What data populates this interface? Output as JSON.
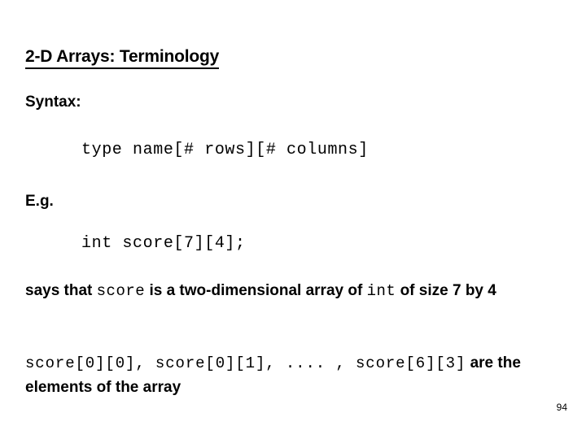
{
  "slide": {
    "title": "2-D Arrays: Terminology",
    "page_number": "94",
    "background_color": "#ffffff",
    "text_color": "#000000",
    "syntax_label": "Syntax:",
    "syntax_code": "type name[# rows][# columns]",
    "example_label": "E.g.",
    "example_code": "int score[7][4];",
    "says_paragraph": {
      "part1": "says that ",
      "mono1": "score",
      "part2": " is a two-dimensional array of ",
      "mono2": "int",
      "part3": " of size 7 by 4"
    },
    "elements_paragraph": {
      "mono1": "score[0][0], score[0][1], .... , score[6][3]",
      "part1": " are the elements of the array"
    }
  }
}
